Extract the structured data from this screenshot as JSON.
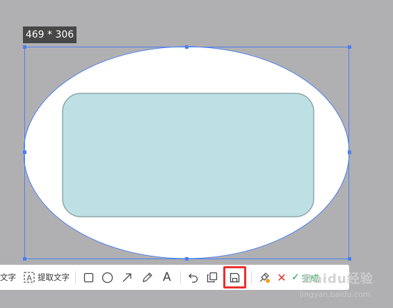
{
  "size_badge": {
    "text": "469 * 306"
  },
  "colors": {
    "backdrop": "#b0b0b2",
    "selection": "#4a7ff0",
    "ellipse_fill": "#ffffff",
    "rect_fill": "#bce0e3",
    "rect_stroke": "#8fa6a8",
    "save_highlight": "#e8302b",
    "cancel": "#e8302b",
    "done": "#1aa34a"
  },
  "toolbar": {
    "text_cut_label": "文字",
    "extract_text_label": "提取文字",
    "tools": [
      {
        "name": "rectangle-tool",
        "icon": "square-icon"
      },
      {
        "name": "ellipse-tool",
        "icon": "circle-icon"
      },
      {
        "name": "arrow-tool",
        "icon": "arrow-icon"
      },
      {
        "name": "pen-tool",
        "icon": "pencil-icon"
      },
      {
        "name": "text-tool",
        "icon": "text-a-icon"
      },
      {
        "name": "undo",
        "icon": "undo-icon"
      },
      {
        "name": "copy",
        "icon": "copy-icon"
      },
      {
        "name": "save",
        "icon": "save-icon"
      },
      {
        "name": "pin",
        "icon": "pin-icon"
      },
      {
        "name": "cancel",
        "icon": "close-icon"
      },
      {
        "name": "done",
        "icon": "check-icon"
      }
    ],
    "text_tool_glyph": "A",
    "cancel_glyph": "✕",
    "done_glyph": "✓",
    "done_label": "完成"
  },
  "watermark": {
    "main": "Baidu经验",
    "sub": "jingyan.baidu.com"
  }
}
